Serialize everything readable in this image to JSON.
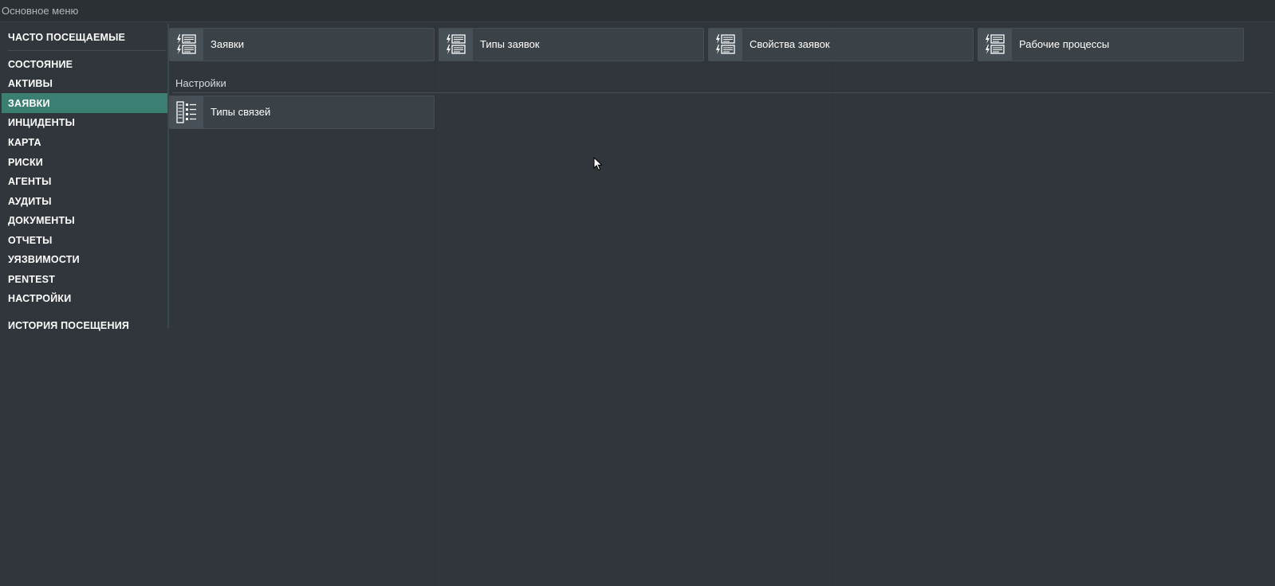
{
  "window": {
    "title": "Основное меню"
  },
  "sidebar": {
    "items": [
      {
        "label": "ЧАСТО ПОСЕЩАЕМЫЕ",
        "active": false
      },
      {
        "label": "СОСТОЯНИЕ",
        "active": false
      },
      {
        "label": "АКТИВЫ",
        "active": false
      },
      {
        "label": "ЗАЯВКИ",
        "active": true
      },
      {
        "label": "ИНЦИДЕНТЫ",
        "active": false
      },
      {
        "label": "КАРТА",
        "active": false
      },
      {
        "label": "РИСКИ",
        "active": false
      },
      {
        "label": "АГЕНТЫ",
        "active": false
      },
      {
        "label": "АУДИТЫ",
        "active": false
      },
      {
        "label": "ДОКУМЕНТЫ",
        "active": false
      },
      {
        "label": "ОТЧЕТЫ",
        "active": false
      },
      {
        "label": "УЯЗВИМОСТИ",
        "active": false
      },
      {
        "label": "PENTEST",
        "active": false
      },
      {
        "label": "НАСТРОЙКИ",
        "active": false
      },
      {
        "label": "ИСТОРИЯ ПОСЕЩЕНИЯ",
        "active": false
      }
    ]
  },
  "main": {
    "tiles": [
      {
        "label": "Заявки",
        "icon": "ticket-list-icon"
      },
      {
        "label": "Типы заявок",
        "icon": "ticket-list-icon"
      },
      {
        "label": "Свойства заявок",
        "icon": "ticket-list-icon"
      },
      {
        "label": "Рабочие процессы",
        "icon": "ticket-list-icon"
      }
    ],
    "settings": {
      "title": "Настройки",
      "tiles": [
        {
          "label": "Типы связей",
          "icon": "link-types-icon"
        }
      ]
    }
  },
  "colors": {
    "accent": "#3b7f73",
    "background": "#30363b",
    "tile": "#3b4247",
    "tile_icon_bg": "#475057"
  }
}
